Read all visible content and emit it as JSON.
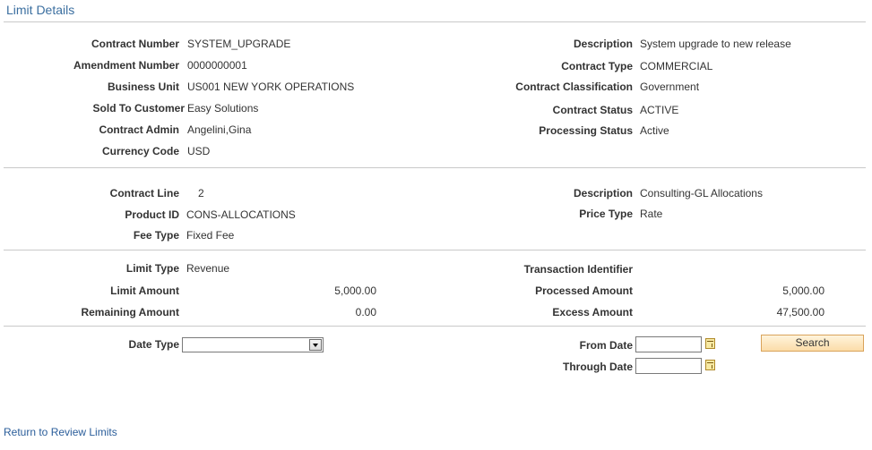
{
  "page_title": "Limit Details",
  "header": {
    "contract_number_label": "Contract Number",
    "contract_number": "SYSTEM_UPGRADE",
    "amendment_number_label": "Amendment Number",
    "amendment_number": "0000000001",
    "business_unit_label": "Business Unit",
    "business_unit": "US001 NEW YORK OPERATIONS",
    "sold_to_label": "Sold To Customer",
    "sold_to": "Easy Solutions",
    "contract_admin_label": "Contract Admin",
    "contract_admin": "Angelini,Gina",
    "currency_label": "Currency Code",
    "currency": "USD",
    "description_label": "Description",
    "description": "System upgrade to new release",
    "contract_type_label": "Contract Type",
    "contract_type": "COMMERCIAL",
    "classification_label": "Contract Classification",
    "classification": "Government",
    "status_label": "Contract Status",
    "status": "ACTIVE",
    "processing_status_label": "Processing Status",
    "processing_status": "Active"
  },
  "line": {
    "contract_line_label": "Contract Line",
    "contract_line": "2",
    "product_id_label": "Product ID",
    "product_id": "CONS-ALLOCATIONS",
    "fee_type_label": "Fee Type",
    "fee_type": "Fixed Fee",
    "description_label": "Description",
    "description": "Consulting-GL Allocations",
    "price_type_label": "Price Type",
    "price_type": "Rate"
  },
  "limits": {
    "limit_type_label": "Limit Type",
    "limit_type": "Revenue",
    "limit_amount_label": "Limit Amount",
    "limit_amount": "5,000.00",
    "remaining_amount_label": "Remaining Amount",
    "remaining_amount": "0.00",
    "transaction_id_label": "Transaction Identifier",
    "processed_amount_label": "Processed Amount",
    "processed_amount": "5,000.00",
    "excess_amount_label": "Excess Amount",
    "excess_amount": "47,500.00"
  },
  "filters": {
    "date_type_label": "Date Type",
    "date_type_value": "",
    "from_date_label": "From Date",
    "from_date_value": "",
    "through_date_label": "Through Date",
    "through_date_value": "",
    "search_label": "Search"
  },
  "footer": {
    "return_link": "Return to Review Limits"
  }
}
